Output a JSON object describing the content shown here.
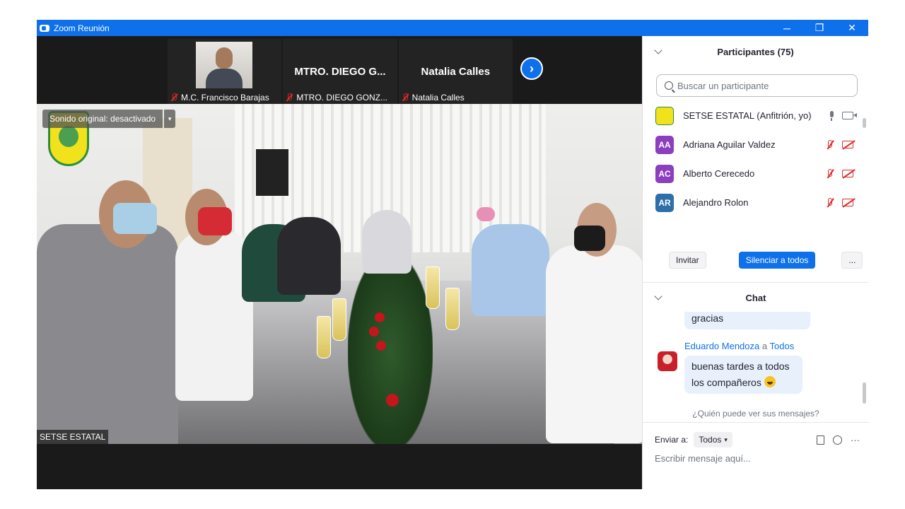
{
  "window": {
    "title": "Zoom Reunión",
    "controls": {
      "minimize": "─",
      "restore": "❐",
      "close": "✕"
    }
  },
  "strip": {
    "tiles": [
      {
        "big_name": "",
        "caption": "M.C. Francisco Barajas"
      },
      {
        "big_name": "MTRO. DIEGO G...",
        "caption": "MTRO. DIEGO GONZ..."
      },
      {
        "big_name": "Natalia Calles",
        "caption": "Natalia Calles"
      }
    ],
    "next_arrow": "›"
  },
  "main_video": {
    "original_sound": "Sonido original: desactivado",
    "caret": "▾",
    "name_tag": "SETSE ESTATAL"
  },
  "participants": {
    "header": "Participantes (75)",
    "search_placeholder": "Buscar un participante",
    "list": [
      {
        "initials": "",
        "name": "SETSE ESTATAL (Anfitrión, yo)",
        "color": "#f2e21c",
        "audio": "on",
        "video": "on"
      },
      {
        "initials": "AA",
        "name": "Adriana Aguilar Valdez",
        "color": "#8b3fbf",
        "audio": "muted",
        "video": "off"
      },
      {
        "initials": "AC",
        "name": "Alberto Cerecedo",
        "color": "#8b3fbf",
        "audio": "muted",
        "video": "off"
      },
      {
        "initials": "AR",
        "name": "Alejandro Rolon",
        "color": "#2d6fa8",
        "audio": "muted",
        "video": "off"
      }
    ],
    "buttons": {
      "invite": "Invitar",
      "mute_all": "Silenciar a todos",
      "more": "..."
    }
  },
  "chat": {
    "header": "Chat",
    "prev_message": "gracias",
    "sender": "Eduardo Mendoza",
    "connector": "a",
    "recipient": "Todos",
    "message_line1": "buenas tardes a todos",
    "message_line2": "los compañeros",
    "who_sees": "¿Quién puede ver sus mensajes?",
    "send_to_label": "Enviar a:",
    "send_to_value": "Todos",
    "more": "···",
    "compose_placeholder": "Escribir mensaje aquí..."
  },
  "colors": {
    "accent": "#0e71eb",
    "muted_red": "#e02828"
  }
}
